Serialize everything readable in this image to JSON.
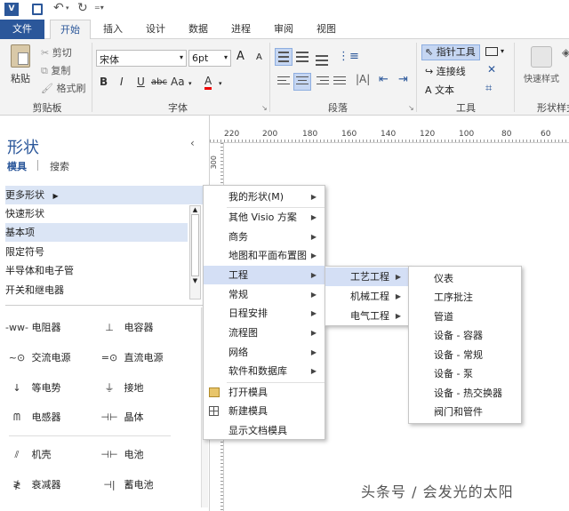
{
  "quick_access": {
    "app_icon": "visio-icon",
    "save": "save-icon",
    "undo": "undo-icon",
    "redo": "redo-icon",
    "customize": "customize-icon"
  },
  "tabs": [
    "文件",
    "开始",
    "插入",
    "设计",
    "数据",
    "进程",
    "审阅",
    "视图"
  ],
  "active_tab": "开始",
  "clipboard": {
    "paste": "粘贴",
    "cut": "剪切",
    "copy": "复制",
    "format_painter": "格式刷",
    "group": "剪贴板"
  },
  "font": {
    "name": "宋体",
    "size": "6pt",
    "group": "字体",
    "bold": "B",
    "italic": "I",
    "underline": "U",
    "strike": "abc",
    "case": "Aa",
    "color_a": "A",
    "grow": "A",
    "shrink": "A"
  },
  "paragraph": {
    "group": "段落"
  },
  "tools": {
    "pointer": "指针工具",
    "connector": "连接线",
    "text": "文本",
    "text_a": "A",
    "group": "工具"
  },
  "shape_styles": {
    "quick": "快速样式",
    "group": "形状样式"
  },
  "shapes_pane": {
    "title": "形状",
    "tab_stencils": "模具",
    "tab_search": "搜索"
  },
  "stencil_list": [
    "更多形状",
    "快速形状",
    "基本项",
    "限定符号",
    "半导体和电子管",
    "开关和继电器"
  ],
  "shapes": [
    {
      "icon": "resistor-icon",
      "glyph": "-ww-",
      "label": "电阻器"
    },
    {
      "icon": "capacitor-icon",
      "glyph": "⊥",
      "label": "电容器"
    },
    {
      "icon": "ac-source-icon",
      "glyph": "~⊙",
      "label": "交流电源"
    },
    {
      "icon": "dc-source-icon",
      "glyph": "=⊙",
      "label": "直流电源"
    },
    {
      "icon": "ammeter-icon",
      "glyph": "↓",
      "label": "等电势"
    },
    {
      "icon": "ground-icon",
      "glyph": "⏚",
      "label": "接地"
    },
    {
      "icon": "inductor-icon",
      "glyph": "ᗰ",
      "label": "电感器"
    },
    {
      "icon": "crystal-icon",
      "glyph": "⊣⊢",
      "label": "晶体"
    },
    {
      "icon": "chassis-icon",
      "glyph": "⫽",
      "label": "机壳"
    },
    {
      "icon": "battery-icon",
      "glyph": "⊣⊢",
      "label": "电池"
    },
    {
      "icon": "attenuator-icon",
      "glyph": "≹",
      "label": "衰减器"
    },
    {
      "icon": "storage-battery-icon",
      "glyph": "⊣|",
      "label": "蓄电池"
    }
  ],
  "menu1": [
    "我的形状(M)",
    "其他 Visio 方案",
    "商务",
    "地图和平面布置图",
    "工程",
    "常规",
    "日程安排",
    "流程图",
    "网络",
    "软件和数据库",
    "打开模具",
    "新建模具",
    "显示文档模具"
  ],
  "menu1_icons": {
    "open": "open-stencil-icon",
    "new": "new-stencil-icon"
  },
  "menu2": [
    "工艺工程",
    "机械工程",
    "电气工程"
  ],
  "menu3": [
    "仪表",
    "工序批注",
    "管道",
    "设备 - 容器",
    "设备 - 常规",
    "设备 - 泵",
    "设备 - 热交换器",
    "阀门和管件"
  ],
  "ruler_top": [
    "220",
    "200",
    "180",
    "160",
    "140",
    "120",
    "100",
    "80",
    "60"
  ],
  "ruler_left": [
    "300",
    "280",
    "260",
    "240",
    "220",
    "200",
    "180",
    "160",
    "140",
    "120",
    "100"
  ],
  "watermark": "头条号 / 会发光的太阳",
  "colors": {
    "accent": "#2b579a",
    "highlight": "#dbe5f5",
    "menu_hover": "#d4dff5"
  }
}
